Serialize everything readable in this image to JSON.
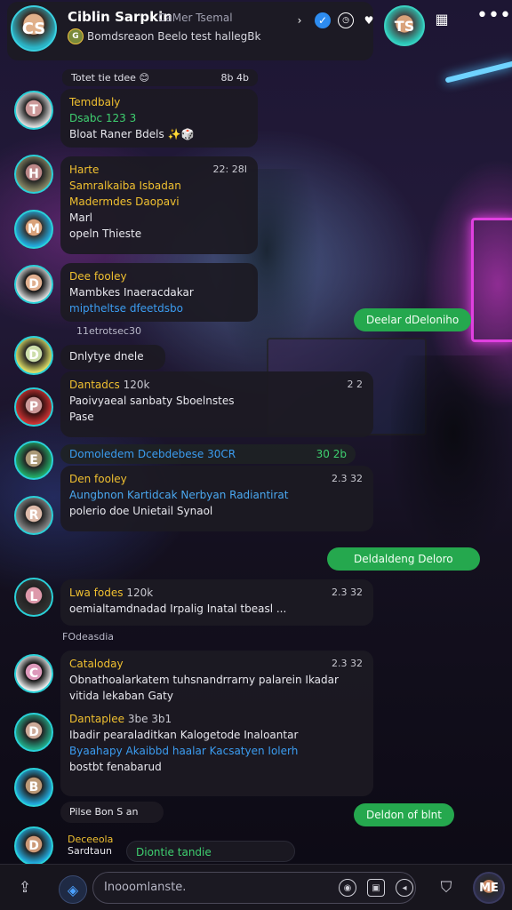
{
  "header": {
    "title": "Ciblin Sarpkin",
    "title_sub": "CaMer Tsemal",
    "status": "Bomdsreaon Beelo test hallegBk",
    "main_avatar": "avatar-portrait",
    "mini_avatar": "group-avatar",
    "icons": [
      "chevron-right-icon",
      "verified-icon",
      "clock-icon",
      "heart-icon"
    ],
    "right_avatar": "contact-portrait",
    "calendar_icon": "calendar-icon",
    "more_icon": "more-dots-icon"
  },
  "messages": [
    {
      "date": "Totet tie tdee",
      "emoji": "😊",
      "time": "8b 4b"
    },
    {
      "name": "Temdbaly",
      "sub": "Dsabc 123 3",
      "text": "Bloat Raner Bdels ✨🎲"
    },
    {
      "name": "Harte",
      "time": "22: 28I",
      "line1": "Samralkaiba Isbadan",
      "line2": "Madermdes Daopavi",
      "line3": "Marl",
      "line4": "opeln Thieste"
    },
    {
      "name": "Dee fooley",
      "line1": "Mambkes Inaeracdakar",
      "line2": "miptheltse dfeetdsbo"
    },
    {
      "outgoing": "Deelar dDeloniho",
      "time": "11etrotsec30"
    },
    {
      "bubble": "Dnlytye dnele"
    },
    {
      "name": "Dantadcs",
      "time": "120k",
      "date": "2 2",
      "line1": "Paoivyaeal sanbaty Sboelnstes",
      "line2": "Pase"
    },
    {
      "name": "Domoledem Dcebdebese 30CR",
      "time": "30 2b"
    },
    {
      "name": "Den fooley",
      "time": "2.3 32",
      "line1": "Aungbnon Kartidcak Nerbyan Radiantirat",
      "line2": "polerio doe Unietail Synaol"
    },
    {
      "outgoing": "Deldaldeng Deloro"
    },
    {
      "name": "Lwa fodes",
      "time": "120k",
      "date": "2.3 32",
      "line1": "oemialtamdnadad Irpalig Inatal tbeasl ..."
    },
    {
      "system": "FOdeasdia"
    },
    {
      "name": "Cataloday",
      "time": "2.3 32",
      "line1": "Obnathoalarkatem tuhsnandrrarny palarein Ikadar",
      "line2": "vitida lekaban Gaty"
    },
    {
      "name": "Dantaplee",
      "time": "3be 3b1",
      "line1": "Ibadir pearaladitkan Kalogetode Inaloantar",
      "line2": "Byaahapy Akaibbd haalar Kacsatyen Iolerh",
      "line3": "bostbt fenabarud"
    },
    {
      "bubble": "Pilse Bon S an"
    },
    {
      "outgoing": "Deldon of blnt"
    },
    {
      "name": "Deceeola",
      "sub": "Sardtaun"
    },
    {
      "typing": "Diontie tandie"
    }
  ],
  "composer": {
    "placeholder": "Inooomlanste.",
    "attach_icon": "attach-icon",
    "sticker_icon": "sticker-icon",
    "mic_icon": "mic-icon",
    "camera_icon": "camera-icon",
    "send_icon": "send-icon",
    "shield_icon": "shield-icon",
    "profile_avatar": "profile-avatar"
  }
}
